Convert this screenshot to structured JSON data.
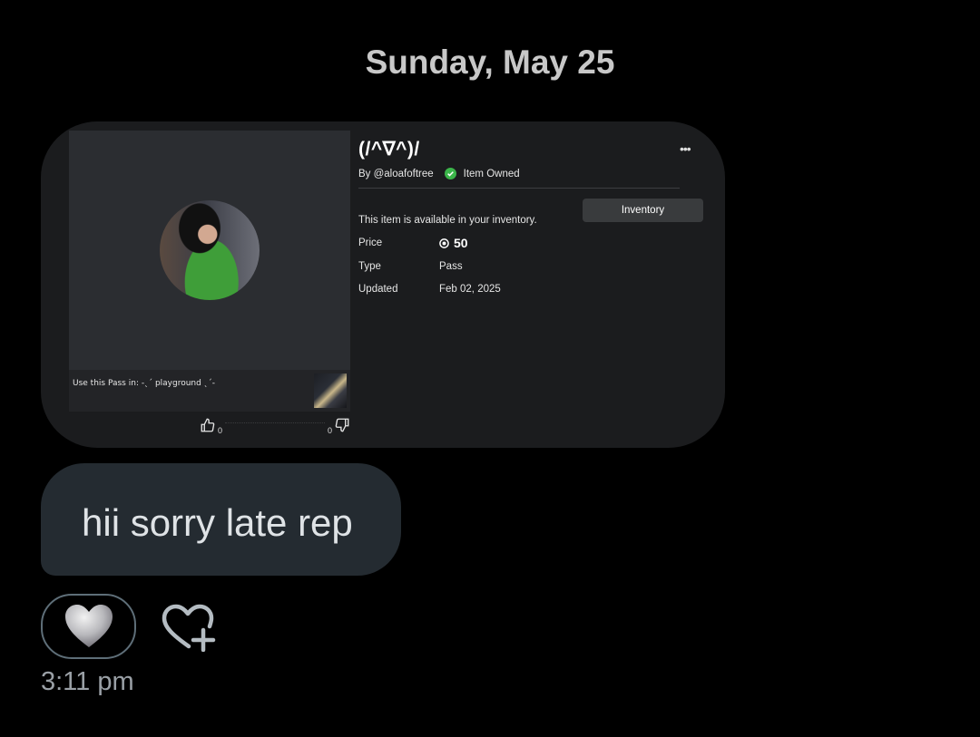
{
  "date_header": "Sunday, May 25",
  "card": {
    "title": "(/^∇^)/",
    "author": "By @aloafoftree",
    "owned_label": "Item Owned",
    "availability": "This item is available in your inventory.",
    "inventory_button": "Inventory",
    "price_label": "Price",
    "price_value": "50",
    "type_label": "Type",
    "type_value": "Pass",
    "updated_label": "Updated",
    "updated_value": "Feb 02, 2025",
    "use_in_text": "Use this Pass in: -ˎˊ playground ˎˊ-",
    "upvotes": "0",
    "downvotes": "0",
    "more_icon": "more-dots-icon",
    "owned_color": "#3bb54a"
  },
  "message": {
    "text": "hii sorry late rep",
    "time": "3:11 pm"
  },
  "reactions": {
    "heart_icon": "grey-heart-emoji",
    "add_reaction_icon": "heart-plus-icon"
  }
}
